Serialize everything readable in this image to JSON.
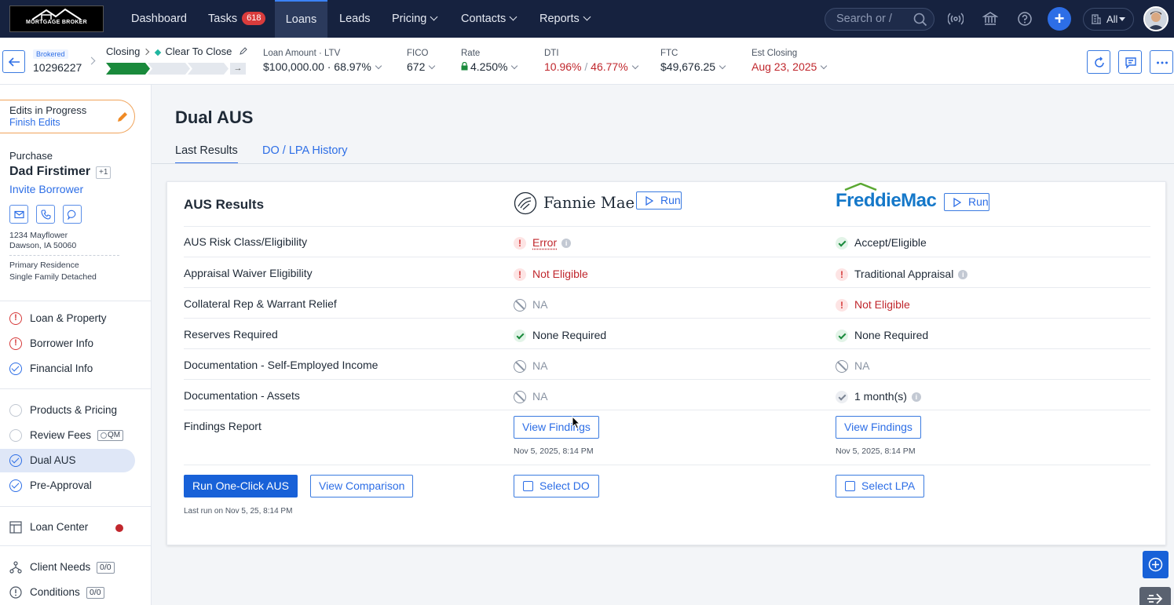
{
  "brand": {
    "logo_text": "MORTGAGE BROKER",
    "accent": "#2d6ee6",
    "nav_bg": "#16223f"
  },
  "topnav": {
    "items": [
      {
        "label": "Dashboard"
      },
      {
        "label": "Tasks",
        "badge": "618"
      },
      {
        "label": "Loans",
        "active": true
      },
      {
        "label": "Leads"
      },
      {
        "label": "Pricing",
        "dropdown": true
      },
      {
        "label": "Contacts",
        "dropdown": true
      },
      {
        "label": "Reports",
        "dropdown": true
      }
    ],
    "search_placeholder": "Search or /",
    "scope_label": "All",
    "icons": [
      "broadcast-icon",
      "bank-icon",
      "help-icon",
      "plus-icon",
      "building-icon",
      "user-avatar"
    ]
  },
  "loan_header": {
    "channel": "Brokered",
    "loan_number": "10296227",
    "stage": "Closing",
    "status": "Clear To Close",
    "progress_segments_done": 1,
    "progress_segments_total": 3,
    "metrics": [
      {
        "label": "Loan Amount · LTV",
        "value": "$100,000.00 · 68.97%"
      },
      {
        "label": "FICO",
        "value": "672"
      },
      {
        "label": "Rate",
        "value": "4.250%",
        "locked": true
      },
      {
        "label": "DTI",
        "value_a": "10.96%",
        "sep": "/",
        "value_b": "46.77%",
        "alert": true
      },
      {
        "label": "FTC",
        "value": "$49,676.25"
      },
      {
        "label": "Est Closing",
        "value": "Aug 23, 2025",
        "alert": true
      }
    ]
  },
  "sidebar": {
    "edits": {
      "title": "Edits in Progress",
      "action": "Finish Edits"
    },
    "purpose": "Purchase",
    "borrower": "Dad Firstimer",
    "extra_borrowers": "+1",
    "invite": "Invite Borrower",
    "address_line1": "1234 Mayflower",
    "address_line2": "Dawson, IA 50060",
    "occupancy": "Primary Residence",
    "property_type": "Single Family Detached",
    "steps": [
      {
        "label": "Loan & Property",
        "state": "warning"
      },
      {
        "label": "Borrower Info",
        "state": "warning"
      },
      {
        "label": "Financial Info",
        "state": "complete"
      },
      {
        "label": "Products & Pricing",
        "state": "empty"
      },
      {
        "label": "Review Fees",
        "state": "empty",
        "tag": "QM"
      },
      {
        "label": "Dual AUS",
        "state": "complete",
        "selected": true
      },
      {
        "label": "Pre-Approval",
        "state": "complete"
      }
    ],
    "loan_center": "Loan Center",
    "client_needs": {
      "label": "Client Needs",
      "count": "0/0"
    },
    "conditions": {
      "label": "Conditions",
      "count": "0/0"
    }
  },
  "main": {
    "title": "Dual AUS",
    "tabs": [
      {
        "label": "Last Results",
        "active": true
      },
      {
        "label": "DO / LPA History"
      }
    ],
    "card": {
      "title": "AUS Results",
      "fannie_name": "Fannie Mae",
      "freddie_name": "FreddieMac",
      "run_label": "Run",
      "rows": [
        {
          "label": "AUS Risk Class/Eligibility",
          "fannie": {
            "text": "Error",
            "status": "error",
            "info": true
          },
          "freddie": {
            "text": "Accept/Eligible",
            "status": "ok"
          }
        },
        {
          "label": "Appraisal Waiver Eligibility",
          "fannie": {
            "text": "Not Eligible",
            "status": "error"
          },
          "freddie": {
            "text": "Traditional Appraisal",
            "status": "error-dark",
            "info": true
          }
        },
        {
          "label": "Collateral Rep & Warrant Relief",
          "fannie": {
            "text": "NA",
            "status": "na"
          },
          "freddie": {
            "text": "Not Eligible",
            "status": "error"
          }
        },
        {
          "label": "Reserves Required",
          "fannie": {
            "text": "None Required",
            "status": "ok"
          },
          "freddie": {
            "text": "None Required",
            "status": "ok"
          }
        },
        {
          "label": "Documentation - Self-Employed Income",
          "fannie": {
            "text": "NA",
            "status": "na"
          },
          "freddie": {
            "text": "NA",
            "status": "na"
          }
        },
        {
          "label": "Documentation - Assets",
          "fannie": {
            "text": "NA",
            "status": "na"
          },
          "freddie": {
            "text": "1 month(s)",
            "status": "okgray",
            "info": true
          }
        }
      ],
      "findings": {
        "label": "Findings Report",
        "button": "View Findings",
        "fannie_time": "Nov 5, 2025, 8:14 PM",
        "freddie_time": "Nov 5, 2025, 8:14 PM"
      },
      "run_one_click": "Run One-Click AUS",
      "view_comparison": "View Comparison",
      "select_do": "Select DO",
      "select_lpa": "Select LPA",
      "last_run": "Last run on Nov 5, 25, 8:14 PM"
    }
  }
}
